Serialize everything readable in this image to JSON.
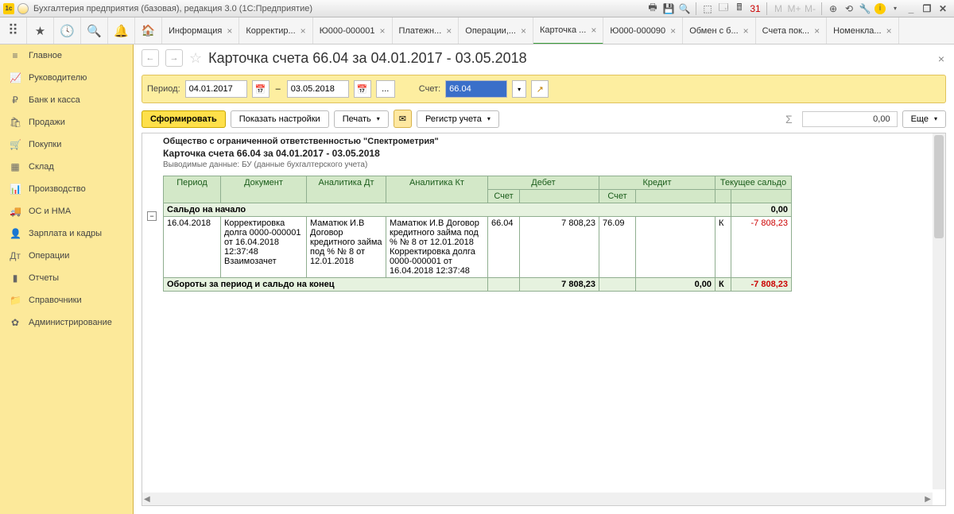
{
  "titlebar": {
    "title": "Бухгалтерия предприятия (базовая), редакция 3.0  (1С:Предприятие)"
  },
  "tabs": [
    {
      "label": "Информация"
    },
    {
      "label": "Корректир..."
    },
    {
      "label": "Ю000-000001"
    },
    {
      "label": "Платежн..."
    },
    {
      "label": "Операции,..."
    },
    {
      "label": "Карточка ...",
      "active": true
    },
    {
      "label": "Ю000-000090"
    },
    {
      "label": "Обмен с б..."
    },
    {
      "label": "Счета пок..."
    },
    {
      "label": "Номенкла..."
    }
  ],
  "sidebar": [
    {
      "icon": "≡",
      "label": "Главное"
    },
    {
      "icon": "📈",
      "label": "Руководителю"
    },
    {
      "icon": "₽",
      "label": "Банк и касса"
    },
    {
      "icon": "🛍",
      "label": "Продажи"
    },
    {
      "icon": "🛒",
      "label": "Покупки"
    },
    {
      "icon": "▦",
      "label": "Склад"
    },
    {
      "icon": "📊",
      "label": "Производство"
    },
    {
      "icon": "🚚",
      "label": "ОС и НМА"
    },
    {
      "icon": "👤",
      "label": "Зарплата и кадры"
    },
    {
      "icon": "Дт",
      "label": "Операции"
    },
    {
      "icon": "▮",
      "label": "Отчеты"
    },
    {
      "icon": "📁",
      "label": "Справочники"
    },
    {
      "icon": "✿",
      "label": "Администрирование"
    }
  ],
  "page": {
    "title": "Карточка счета 66.04 за 04.01.2017 - 03.05.2018"
  },
  "filter": {
    "period_label": "Период:",
    "date_from": "04.01.2017",
    "date_to": "03.05.2018",
    "account_label": "Счет:",
    "account": "66.04"
  },
  "actions": {
    "form": "Сформировать",
    "settings": "Показать настройки",
    "print": "Печать",
    "register": "Регистр учета",
    "sum": "0,00",
    "more": "Еще"
  },
  "report": {
    "org": "Общество с ограниченной ответственностью \"Спектрометрия\"",
    "title": "Карточка счета 66.04 за 04.01.2017 - 03.05.2018",
    "sub": "Выводимые данные:  БУ (данные бухгалтерского учета)",
    "head": {
      "period": "Период",
      "doc": "Документ",
      "adt": "Аналитика Дт",
      "akt": "Аналитика Кт",
      "debit": "Дебет",
      "credit": "Кредит",
      "balance": "Текущее сальдо",
      "acct": "Счет"
    },
    "start_label": "Сальдо на начало",
    "start_balance": "0,00",
    "row": {
      "date": "16.04.2018",
      "doc": "Корректировка долга 0000-000001 от 16.04.2018 12:37:48 Взаимозачет",
      "adt": "Маматюк И.В Договор кредитного займа под % № 8 от 12.01.2018",
      "akt": "Маматюк И.В Договор кредитного займа под % № 8 от 12.01.2018 Корректировка долга 0000-000001 от 16.04.2018 12:37:48",
      "deb_acct": "66.04",
      "deb_val": "7 808,23",
      "cre_acct": "76.09",
      "sign": "К",
      "bal": "-7 808,23"
    },
    "total_label": "Обороты за период и сальдо на конец",
    "total_deb": "7 808,23",
    "total_cre": "0,00",
    "total_sign": "К",
    "total_bal": "-7 808,23"
  }
}
